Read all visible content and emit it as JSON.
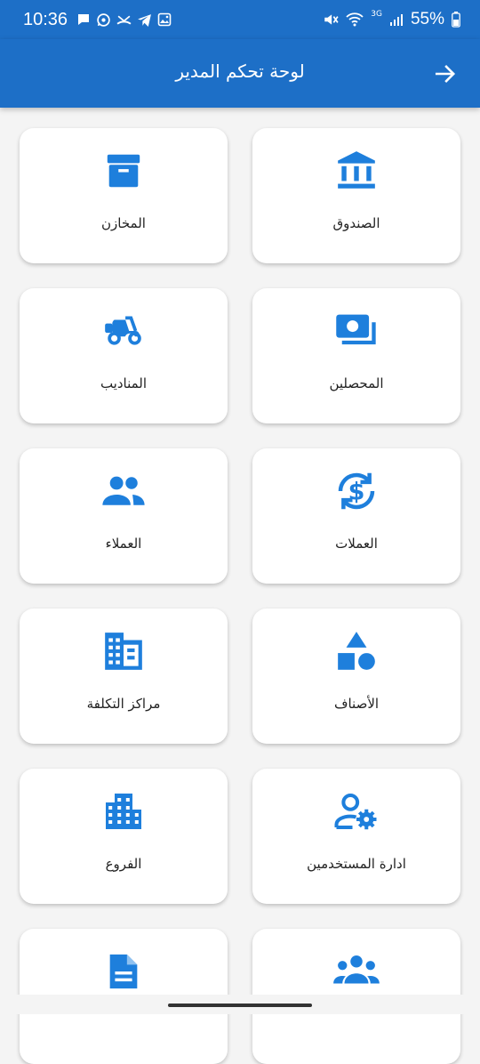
{
  "status": {
    "time": "10:36",
    "network": "3G",
    "battery": "55%"
  },
  "header": {
    "title": "لوحة تحكم المدير"
  },
  "colors": {
    "primary": "#1d6fc7",
    "icon": "#1e7fdc",
    "background": "#f4f4f4",
    "card": "#ffffff"
  },
  "tiles": [
    {
      "label": "الصندوق",
      "icon": "bank-icon"
    },
    {
      "label": "المخازن",
      "icon": "archive-box-icon"
    },
    {
      "label": "المحصلين",
      "icon": "cash-icon"
    },
    {
      "label": "المناديب",
      "icon": "delivery-scooter-icon"
    },
    {
      "label": "العملات",
      "icon": "currency-exchange-icon"
    },
    {
      "label": "العملاء",
      "icon": "people-icon"
    },
    {
      "label": "الأصناف",
      "icon": "category-shapes-icon"
    },
    {
      "label": "مراكز التكلفة",
      "icon": "domain-building-icon"
    },
    {
      "label": "ادارة المستخدمين",
      "icon": "manage-accounts-icon"
    },
    {
      "label": "الفروع",
      "icon": "apartment-icon"
    },
    {
      "label": "",
      "icon": "groups-icon"
    },
    {
      "label": "",
      "icon": "document-icon"
    }
  ]
}
